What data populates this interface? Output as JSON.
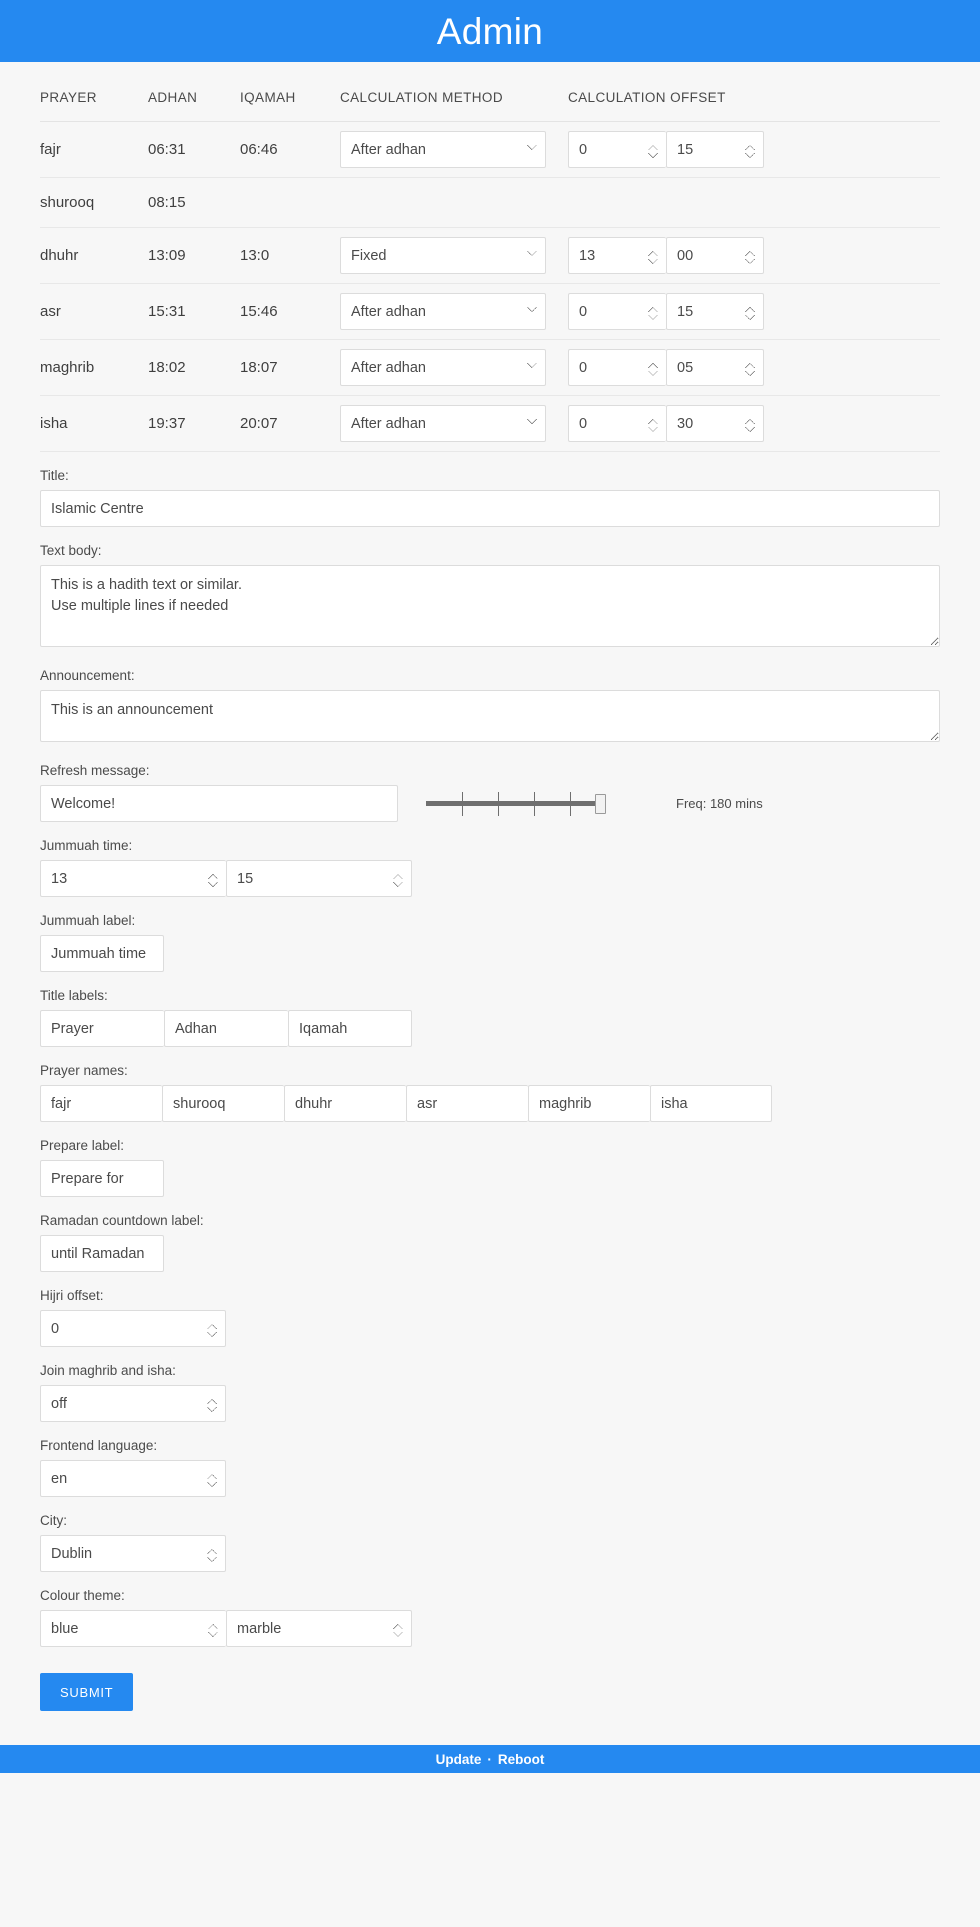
{
  "header": {
    "title": "Admin"
  },
  "table": {
    "columns": [
      "PRAYER",
      "ADHAN",
      "IQAMAH",
      "CALCULATION METHOD",
      "CALCULATION OFFSET"
    ],
    "rows": [
      {
        "prayer": "fajr",
        "adhan": "06:31",
        "iqamah": "06:46",
        "method": "After adhan",
        "offset_h": "0",
        "offset_m": "15",
        "has_controls": true
      },
      {
        "prayer": "shurooq",
        "adhan": "08:15",
        "iqamah": "",
        "method": "",
        "offset_h": "",
        "offset_m": "",
        "has_controls": false
      },
      {
        "prayer": "dhuhr",
        "adhan": "13:09",
        "iqamah": "13:0",
        "method": "Fixed",
        "offset_h": "13",
        "offset_m": "00",
        "has_controls": true
      },
      {
        "prayer": "asr",
        "adhan": "15:31",
        "iqamah": "15:46",
        "method": "After adhan",
        "offset_h": "0",
        "offset_m": "15",
        "has_controls": true
      },
      {
        "prayer": "maghrib",
        "adhan": "18:02",
        "iqamah": "18:07",
        "method": "After adhan",
        "offset_h": "0",
        "offset_m": "05",
        "has_controls": true
      },
      {
        "prayer": "isha",
        "adhan": "19:37",
        "iqamah": "20:07",
        "method": "After adhan",
        "offset_h": "0",
        "offset_m": "30",
        "has_controls": true
      }
    ],
    "method_options": [
      "After adhan",
      "Fixed"
    ]
  },
  "fields": {
    "title": {
      "label": "Title:",
      "value": "Islamic Centre"
    },
    "text_body": {
      "label": "Text body:",
      "value": "This is a hadith text or similar.\nUse multiple lines if needed"
    },
    "announcement": {
      "label": "Announcement:",
      "value": "This is an announcement"
    },
    "refresh_message": {
      "label": "Refresh message:",
      "value": "Welcome!"
    },
    "frequency": {
      "label": "Freq: 180 mins",
      "value": 180,
      "min": 0,
      "max": 180
    },
    "jummuah_time": {
      "label": "Jummuah time:",
      "hour": "13",
      "minute": "15"
    },
    "jummuah_label": {
      "label": "Jummuah label:",
      "value": "Jummuah time"
    },
    "title_labels": {
      "label": "Title labels:",
      "values": [
        "Prayer",
        "Adhan",
        "Iqamah"
      ]
    },
    "prayer_names": {
      "label": "Prayer names:",
      "values": [
        "fajr",
        "shurooq",
        "dhuhr",
        "asr",
        "maghrib",
        "isha"
      ]
    },
    "prepare_label": {
      "label": "Prepare label:",
      "value": "Prepare for"
    },
    "ramadan_label": {
      "label": "Ramadan countdown label:",
      "value": "until Ramadan"
    },
    "hijri_offset": {
      "label": "Hijri offset:",
      "value": "0"
    },
    "join_maghrib_isha": {
      "label": "Join maghrib and isha:",
      "value": "off"
    },
    "frontend_language": {
      "label": "Frontend language:",
      "value": "en"
    },
    "city": {
      "label": "City:",
      "value": "Dublin"
    },
    "colour_theme": {
      "label": "Colour theme:",
      "primary": "blue",
      "secondary": "marble"
    }
  },
  "submit": {
    "label": "SUBMIT"
  },
  "footer": {
    "update": "Update",
    "separator": "·",
    "reboot": "Reboot"
  },
  "colors": {
    "accent": "#2589f0",
    "page_bg": "#f7f7f7",
    "field_bg": "#ffffff",
    "border": "#dcdcdc"
  }
}
